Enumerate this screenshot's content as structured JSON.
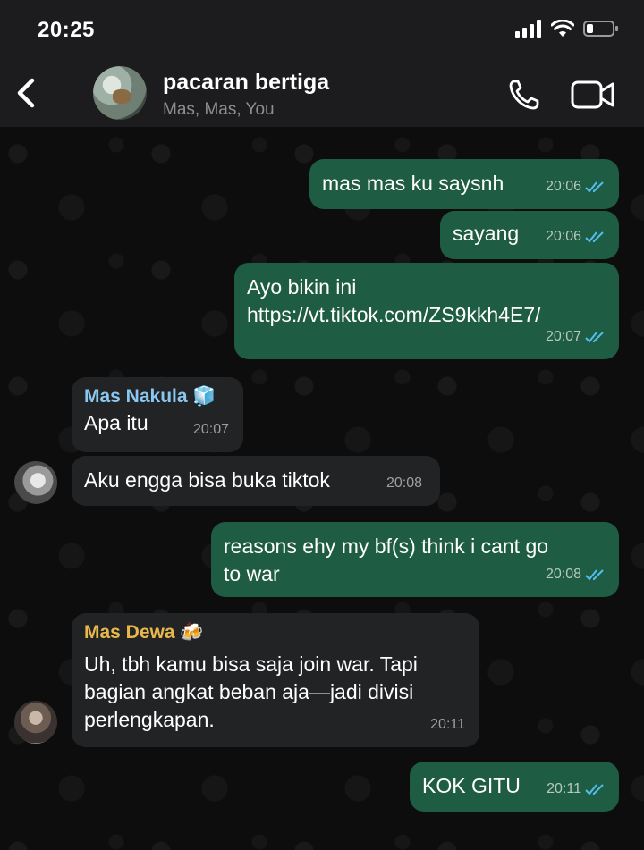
{
  "status_bar": {
    "time": "20:25"
  },
  "header": {
    "title": "pacaran bertiga",
    "subtitle": "Mas, Mas, You"
  },
  "messages": [
    {
      "text": "mas mas ku saysnh",
      "time": "20:06"
    },
    {
      "text": "sayang",
      "time": "20:06"
    },
    {
      "text": "Ayo bikin ini\nhttps://vt.tiktok.com/ZS9kkh4E7/",
      "time": "20:07"
    },
    {
      "sender": "Mas Nakula 🧊",
      "text": "Apa itu",
      "time": "20:07"
    },
    {
      "text": "Aku engga bisa buka tiktok",
      "time": "20:08"
    },
    {
      "text": "reasons ehy my bf(s) think i cant go\nto war",
      "time": "20:08"
    },
    {
      "sender": "Mas Dewa 🍻",
      "text": "Uh, tbh kamu bisa saja join war. Tapi\nbagian angkat beban aja—jadi divisi\nperlengkapan.",
      "time": "20:11"
    },
    {
      "text": "KOK GITU",
      "time": "20:11"
    }
  ]
}
